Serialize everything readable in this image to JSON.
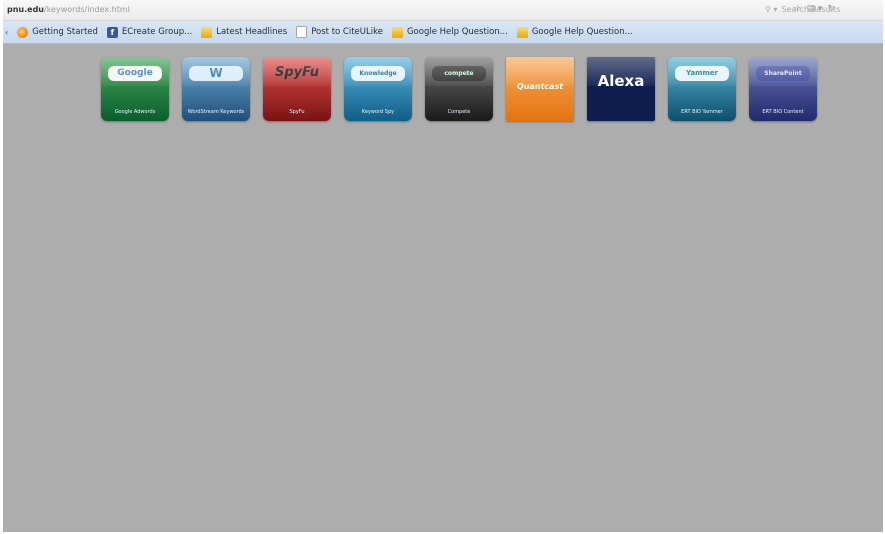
{
  "address_bar": {
    "host": "pnu.edu",
    "path": "/keywords/index.html"
  },
  "search": {
    "placeholder": "Search Results"
  },
  "bookmarks": [
    {
      "label": "Getting Started",
      "icon": "firefox-icon"
    },
    {
      "label": "ECreate Group...",
      "icon": "facebook-icon"
    },
    {
      "label": "Latest Headlines",
      "icon": "rss-feed-icon"
    },
    {
      "label": "Post to CiteULike",
      "icon": "page-icon"
    },
    {
      "label": "Google Help Question...",
      "icon": "rss-feed-icon"
    },
    {
      "label": "Google Help Question...",
      "icon": "rss-feed-icon"
    }
  ],
  "tiles": [
    {
      "logo": "Google",
      "label": "Google Adwords",
      "icon": "google-logo-icon"
    },
    {
      "logo": "W",
      "label": "WordStream Keywords",
      "icon": "wordstream-logo-icon"
    },
    {
      "logo": "SpyFu",
      "label": "SpyFu",
      "icon": "spyfu-logo-icon"
    },
    {
      "logo": "Knowledge",
      "label": "Keyword Spy",
      "icon": "keyword-spy-logo-icon"
    },
    {
      "logo": "compete",
      "label": "Compete",
      "icon": "compete-logo-icon"
    },
    {
      "logo": "Quantcast",
      "label": "",
      "icon": "quantcast-logo-icon"
    },
    {
      "logo": "Alexa",
      "label": "",
      "icon": "alexa-logo-icon"
    },
    {
      "logo": "Yammer",
      "label": "ERT BIO Yammer",
      "icon": "yammer-logo-icon"
    },
    {
      "logo": "SharePoint",
      "label": "ERT BIO Content",
      "icon": "sharepoint-logo-icon"
    }
  ]
}
